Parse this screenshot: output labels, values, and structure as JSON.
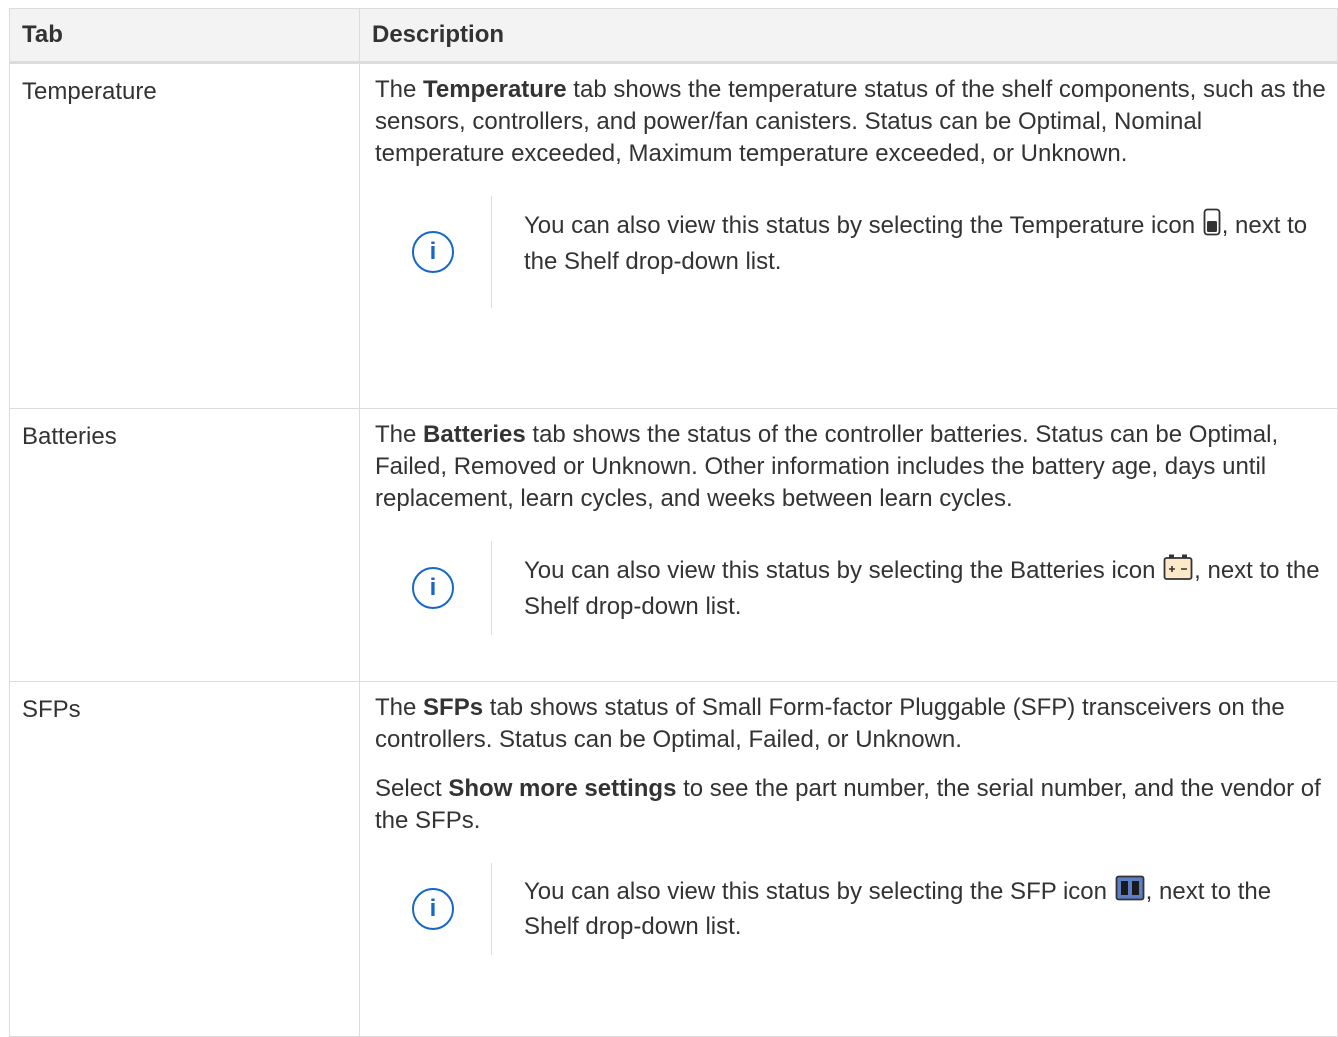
{
  "header": {
    "tab": "Tab",
    "description": "Description"
  },
  "rows": [
    {
      "tab": "Temperature",
      "desc_before": "The ",
      "desc_bold": "Temperature",
      "desc_after": " tab shows the temperature status of the shelf components, such as the sensors, controllers, and power/fan canisters. Status can be Optimal, Nominal temperature exceeded, Maximum temperature exceeded, or Unknown.",
      "note_before": "You can also view this status by selecting the Temperature icon ",
      "note_after": ", next to the Shelf drop-down list.",
      "note_icon": "temperature-icon"
    },
    {
      "tab": "Batteries",
      "desc_before": "The ",
      "desc_bold": "Batteries",
      "desc_after": " tab shows the status of the controller batteries. Status can be Optimal, Failed, Removed or Unknown. Other information includes the battery age, days until replacement, learn cycles, and weeks between learn cycles.",
      "note_before": "You can also view this status by selecting the Batteries icon ",
      "note_after": ", next to the Shelf drop-down list.",
      "note_icon": "battery-icon"
    },
    {
      "tab": "SFPs",
      "desc_before": "The ",
      "desc_bold": "SFPs",
      "desc_after": " tab shows status of Small Form-factor Pluggable (SFP) transceivers on the controllers. Status can be Optimal, Failed, or Unknown.",
      "extra_before": "Select ",
      "extra_bold": "Show more settings",
      "extra_after": " to see the part number, the serial number, and the vendor of the SFPs.",
      "note_before": "You can also view this status by selecting the SFP icon ",
      "note_after": ", next to the Shelf drop-down list.",
      "note_icon": "sfp-icon"
    }
  ],
  "info_glyph": "i",
  "colors": {
    "info_blue": "#1667c9",
    "border": "#dcdcdc",
    "header_bg": "#f3f3f3",
    "text": "#333333"
  }
}
